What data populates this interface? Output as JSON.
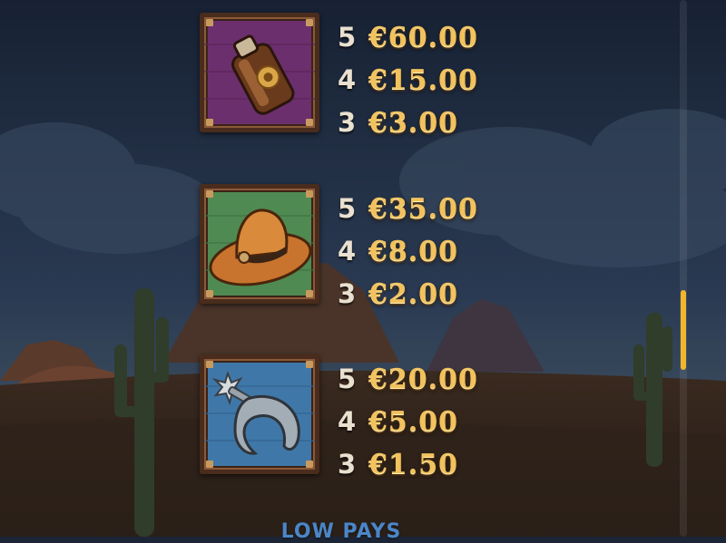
{
  "paytable": {
    "symbols": [
      {
        "name": "flask",
        "tile_color": "#6b2f6e",
        "pays": [
          {
            "count": "5",
            "amount": "€60.00"
          },
          {
            "count": "4",
            "amount": "€15.00"
          },
          {
            "count": "3",
            "amount": "€3.00"
          }
        ]
      },
      {
        "name": "cowboy-hat",
        "tile_color": "#4f8a52",
        "pays": [
          {
            "count": "5",
            "amount": "€35.00"
          },
          {
            "count": "4",
            "amount": "€8.00"
          },
          {
            "count": "3",
            "amount": "€2.00"
          }
        ]
      },
      {
        "name": "spur",
        "tile_color": "#3f78a8",
        "pays": [
          {
            "count": "5",
            "amount": "€20.00"
          },
          {
            "count": "4",
            "amount": "€5.00"
          },
          {
            "count": "3",
            "amount": "€1.50"
          }
        ]
      }
    ],
    "next_section_heading": "LOW PAYS"
  },
  "colors": {
    "amount_gold": "#f1c25d",
    "count_text": "#e9e0cf",
    "scroll_thumb": "#f2b62c",
    "heading_blue": "#4a86c8"
  }
}
